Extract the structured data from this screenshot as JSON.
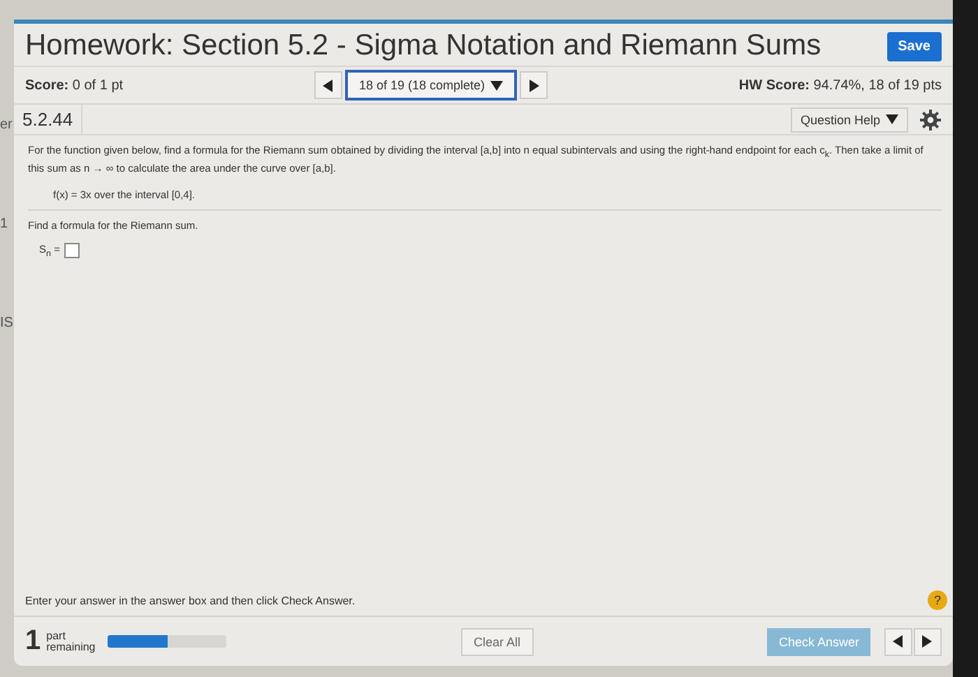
{
  "left_fragments": [
    "er",
    "1",
    "IS"
  ],
  "header": {
    "title": "Homework: Section 5.2 - Sigma Notation and Riemann Sums",
    "save": "Save"
  },
  "score_bar": {
    "score_label": "Score:",
    "score": "0 of 1 pt",
    "navigator": "18 of 19 (18 complete)",
    "hw_label": "HW Score:",
    "hw_score": "94.74%, 18 of 19 pts"
  },
  "question": {
    "number": "5.2.44",
    "help": "Question Help"
  },
  "body": {
    "prompt": "For the function given below, find a formula for the Riemann sum obtained by dividing the interval [a,b] into n equal subintervals and using the right-hand endpoint for each c$_{k}$. Then take a limit of this sum as n → ∞ to calculate the area under the curve over [a,b].",
    "function": "f(x) = 3x over the interval [0,4].",
    "task": "Find a formula for the Riemann sum.",
    "answer_label": "S$_{n}$ ="
  },
  "footer": {
    "instruction": "Enter your answer in the answer box and then click Check Answer.",
    "help_mark": "?",
    "parts_count": "1",
    "parts_text": "part remaining",
    "level": 0.5,
    "clear": "Clear All",
    "check": "Check Answer"
  }
}
